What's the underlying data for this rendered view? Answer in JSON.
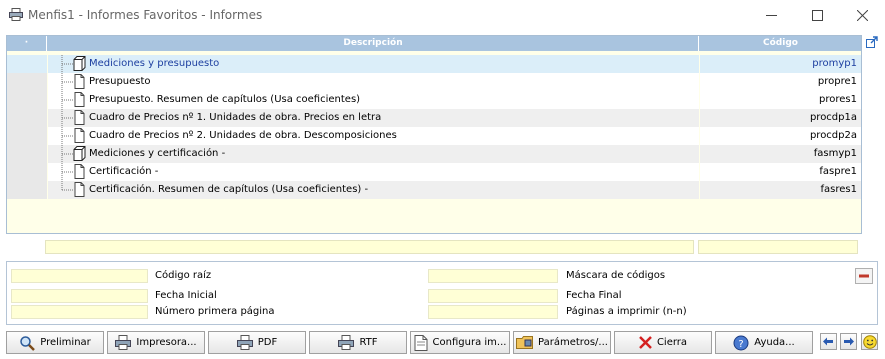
{
  "window": {
    "title": "Menfis1 - Informes Favoritos - Informes"
  },
  "grid": {
    "columns": {
      "dot": "·",
      "description": "Descripción",
      "code": "Código"
    },
    "rows": [
      {
        "label": "Mediciones y presupuesto",
        "code": "promyp1",
        "icon": "book-icon",
        "style": "sel"
      },
      {
        "label": "Presupuesto",
        "code": "propre1",
        "icon": "page-icon",
        "style": "plain"
      },
      {
        "label": "Presupuesto. Resumen de capítulos (Usa coeficientes)",
        "code": "prores1",
        "icon": "page-icon",
        "style": "plain"
      },
      {
        "label": "Cuadro de Precios nº 1. Unidades de obra. Precios en letra",
        "code": "procdp1a",
        "icon": "page-icon",
        "style": "alt"
      },
      {
        "label": "Cuadro de Precios nº 2. Unidades de obra. Descomposiciones",
        "code": "procdp2a",
        "icon": "page-icon",
        "style": "plain"
      },
      {
        "label": "Mediciones y certificación -",
        "code": "fasmyp1",
        "icon": "book-icon",
        "style": "alt"
      },
      {
        "label": "Certificación -",
        "code": "faspre1",
        "icon": "page-icon",
        "style": "plain"
      },
      {
        "label": "Certificación. Resumen de capítulos (Usa coeficientes) -",
        "code": "fasres1",
        "icon": "page-icon",
        "style": "alt"
      }
    ]
  },
  "params": {
    "codigo_raiz_label": "Código raíz",
    "codigo_raiz_value": "",
    "fecha_inicial_label": "Fecha Inicial",
    "fecha_inicial_value": "",
    "numero_primera_pagina_label": "Número primera página",
    "numero_primera_pagina_value": "",
    "mascara_codigos_label": "Máscara de códigos",
    "mascara_codigos_value": "",
    "fecha_final_label": "Fecha Final",
    "fecha_final_value": "",
    "paginas_imprimir_label": "Páginas a imprimir (n-n)",
    "paginas_imprimir_value": ""
  },
  "buttons": {
    "preliminar": "Preliminar",
    "impresora": "Impresora...",
    "pdf": "PDF",
    "rtf": "RTF",
    "configura": "Configura im...",
    "parametros": "Parámetros/...",
    "cierra": "Cierra",
    "ayuda": "Ayuda..."
  },
  "colors": {
    "header": "#a9c4df",
    "selected_row": "#dbeef9",
    "field_bg": "#ffffd6",
    "close_x": "#d42020"
  }
}
